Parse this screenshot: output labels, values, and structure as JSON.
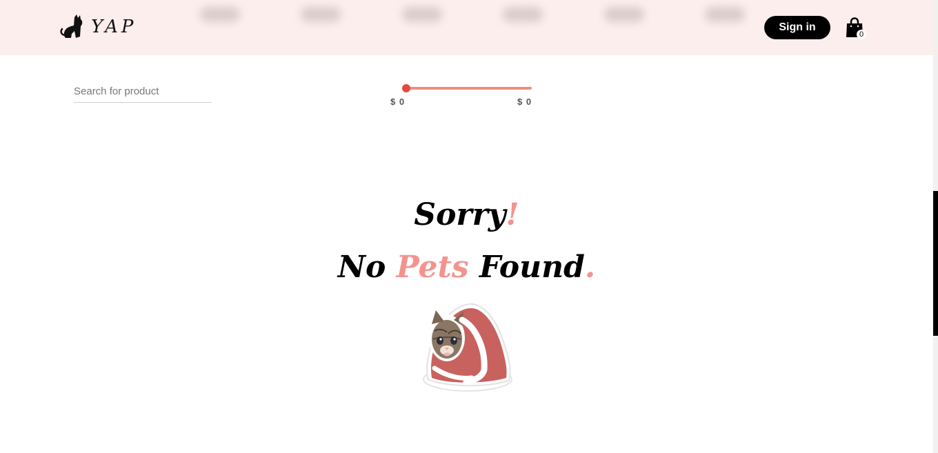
{
  "header": {
    "logo_text": "YAP",
    "signin_label": "Sign in",
    "cart_count": "0"
  },
  "filters": {
    "search_placeholder": "Search for product",
    "price_min_label": "$ 0",
    "price_max_label": "$ 0"
  },
  "empty_state": {
    "line1_word": "Sorry",
    "line1_punct": "!",
    "line2_part1": "No ",
    "line2_highlight": "Pets",
    "line2_part2": " Found",
    "line2_punct": "."
  },
  "colors": {
    "header_bg": "#fdeeee",
    "accent_pink": "#f4938d",
    "slider_track": "#f28b82",
    "slider_handle": "#e8483a"
  },
  "icons": {
    "logo": "cat-logo-icon",
    "cart": "shopping-bag-icon"
  }
}
